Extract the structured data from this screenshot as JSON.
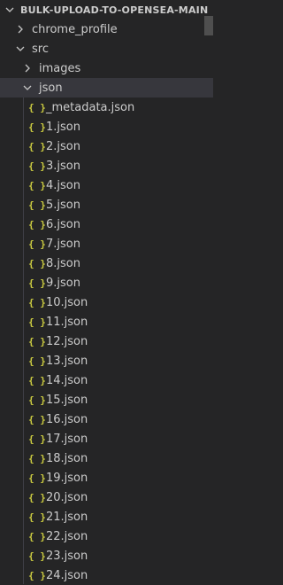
{
  "explorer": {
    "root_label": "BULK-UPLOAD-TO-OPENSEA-MAIN",
    "folders": {
      "chrome_profile": "chrome_profile",
      "src": "src",
      "images": "images",
      "json": "json"
    },
    "files": [
      "_metadata.json",
      "1.json",
      "2.json",
      "3.json",
      "4.json",
      "5.json",
      "6.json",
      "7.json",
      "8.json",
      "9.json",
      "10.json",
      "11.json",
      "12.json",
      "13.json",
      "14.json",
      "15.json",
      "16.json",
      "17.json",
      "18.json",
      "19.json",
      "20.json",
      "21.json",
      "22.json",
      "23.json",
      "24.json"
    ],
    "json_icon_glyph": "{ }"
  },
  "colors": {
    "background": "#252526",
    "selected": "#37373d",
    "json_icon": "#cbcb41",
    "text": "#cccccc"
  }
}
